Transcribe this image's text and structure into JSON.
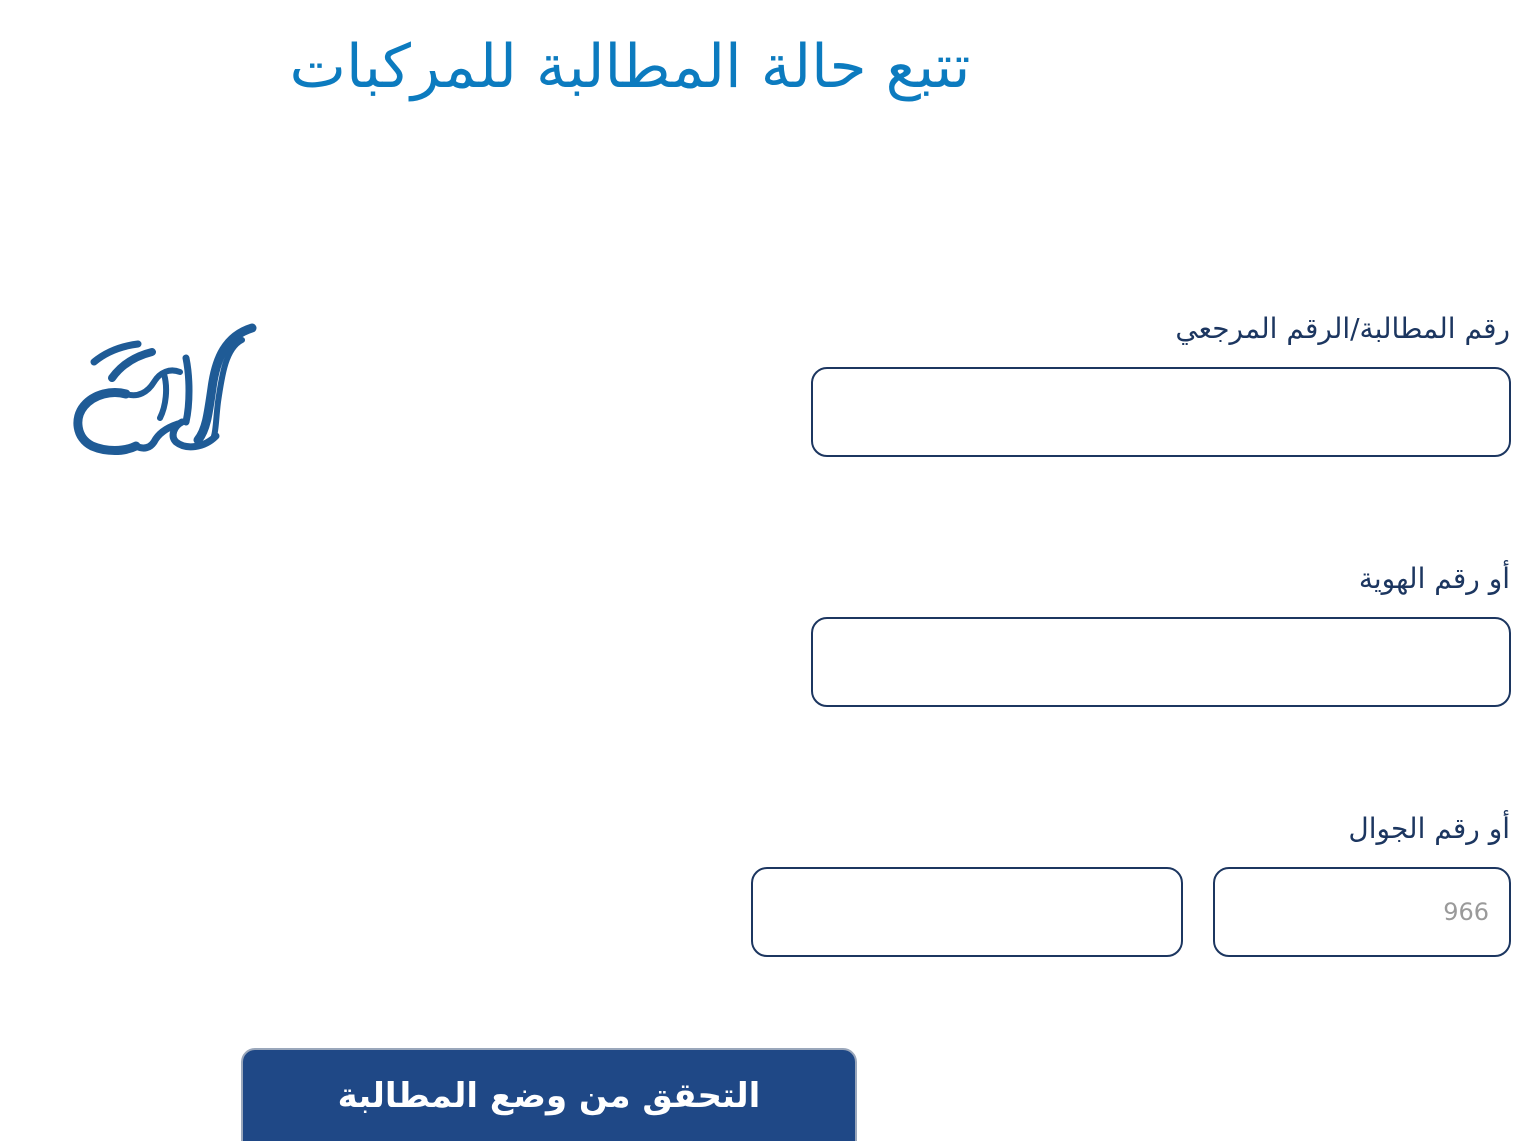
{
  "page": {
    "title": "تتبع حالة المطالبة للمركبات"
  },
  "form": {
    "claim_number_label": "رقم المطالبة/الرقم المرجعي",
    "claim_number_value": "",
    "id_number_label": "أو رقم الهوية",
    "id_number_value": "",
    "mobile_label": "أو رقم الجوال",
    "country_code_placeholder": "966",
    "mobile_number_value": "",
    "submit_label": "التحقق من وضع المطالبة"
  },
  "logo": {
    "text": "المرجع",
    "color": "#1f5b96"
  },
  "colors": {
    "title": "#0c7bbf",
    "label": "#1c3660",
    "input_border": "#1c3660",
    "button_bg": "#1f4886",
    "button_text": "#ffffff"
  }
}
